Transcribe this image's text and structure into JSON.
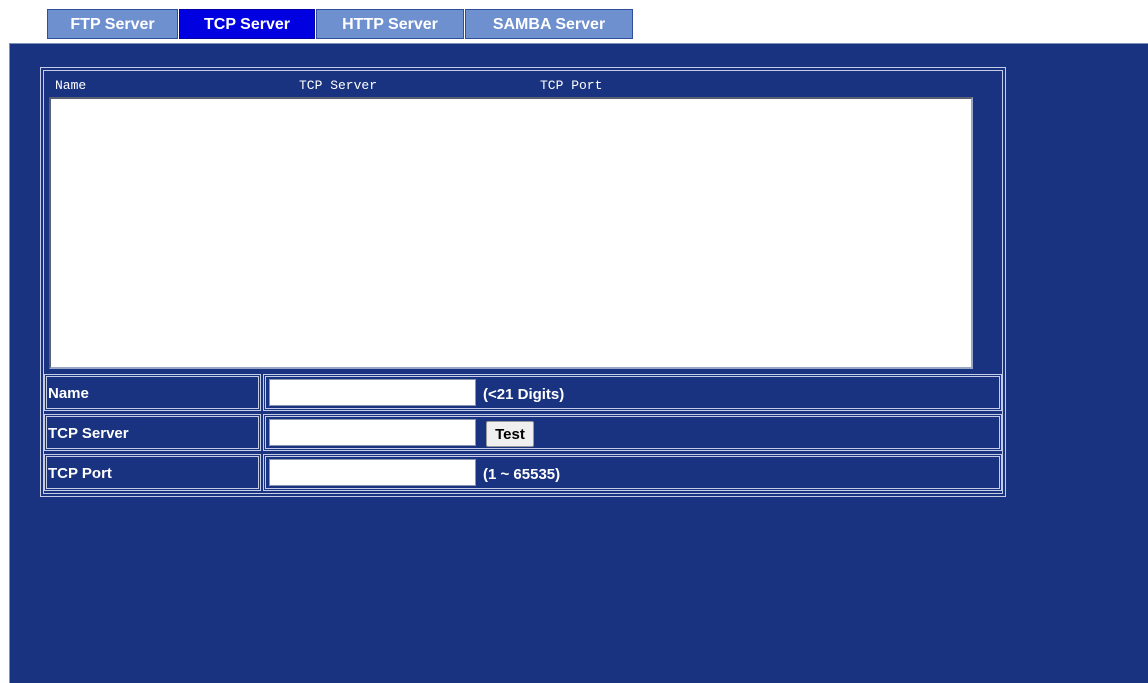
{
  "tabs": [
    {
      "label": "FTP Server",
      "active": false
    },
    {
      "label": "TCP Server",
      "active": true
    },
    {
      "label": "HTTP Server",
      "active": false
    },
    {
      "label": "SAMBA Server",
      "active": false
    }
  ],
  "list": {
    "columns": [
      "Name",
      "TCP Server",
      "TCP Port"
    ],
    "rows": []
  },
  "form": {
    "name": {
      "label": "Name",
      "value": "",
      "hint": "(<21 Digits)"
    },
    "server": {
      "label": "TCP Server",
      "value": "",
      "button": "Test"
    },
    "port": {
      "label": "TCP Port",
      "value": "",
      "hint": "(1 ~ 65535)"
    }
  },
  "colors": {
    "panel_bg": "#1a3380",
    "tab_active": "#0000e0",
    "tab_inactive": "#6f90cf"
  }
}
